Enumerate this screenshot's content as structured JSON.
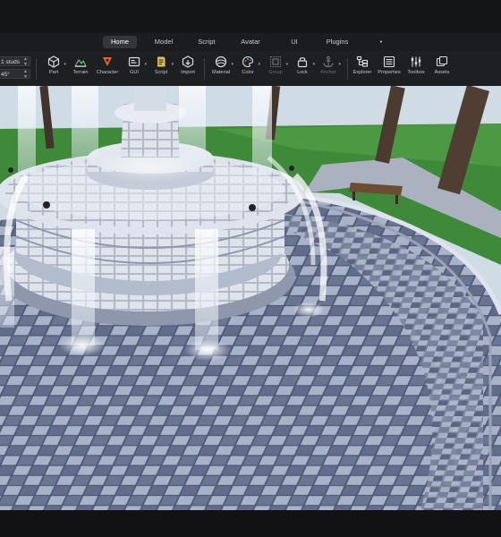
{
  "menu": {
    "tabs": [
      {
        "label": "Home",
        "active": true
      },
      {
        "label": "Model",
        "active": false
      },
      {
        "label": "Script",
        "active": false
      },
      {
        "label": "Avatar",
        "active": false
      },
      {
        "label": "UI",
        "active": false
      },
      {
        "label": "Plugins",
        "active": false
      },
      {
        "label": "•",
        "active": false
      }
    ]
  },
  "ribbon": {
    "studs_value": "1 studs",
    "angle_value": "45°",
    "tools": [
      {
        "label": "Part",
        "icon": "part-cube-icon",
        "has_caret": true
      },
      {
        "label": "Terrain",
        "icon": "terrain-icon",
        "has_caret": false
      },
      {
        "label": "Character",
        "icon": "character-icon",
        "has_caret": false
      },
      {
        "label": "GUI",
        "icon": "gui-icon",
        "has_caret": true
      },
      {
        "label": "Script",
        "icon": "script-icon",
        "has_caret": true
      },
      {
        "label": "Import",
        "icon": "import-icon",
        "has_caret": false
      },
      {
        "label": "Material",
        "icon": "material-icon",
        "has_caret": true
      },
      {
        "label": "Color",
        "icon": "color-palette-icon",
        "has_caret": true
      },
      {
        "label": "Group",
        "icon": "group-icon",
        "has_caret": true,
        "disabled": true
      },
      {
        "label": "Lock",
        "icon": "lock-icon",
        "has_caret": true
      },
      {
        "label": "Anchor",
        "icon": "anchor-icon",
        "has_caret": true,
        "disabled": true
      },
      {
        "label": "Explorer",
        "icon": "explorer-icon",
        "has_caret": false
      },
      {
        "label": "Properties",
        "icon": "properties-icon",
        "has_caret": false
      },
      {
        "label": "Toolbox",
        "icon": "toolbox-icon",
        "has_caret": false
      },
      {
        "label": "Assets",
        "icon": "assets-icon",
        "has_caret": false
      }
    ]
  },
  "colors": {
    "accent_orange": "#e8632b",
    "accent_blue": "#3b7ddd",
    "grass": "#3f8a3a",
    "sky": "#cfdce6",
    "tile_dark": "#5f6a84",
    "tile_light": "#b9c2d4"
  },
  "viewport": {
    "scene_icon": "fountain-scene"
  }
}
